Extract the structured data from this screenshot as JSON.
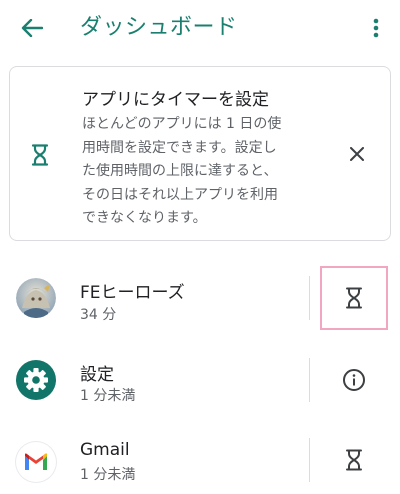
{
  "header": {
    "title": "ダッシュボード",
    "back_icon": "arrow-back-icon",
    "menu_icon": "more-vert-icon"
  },
  "timer_card": {
    "title": "アプリにタイマーを設定",
    "body_lines": [
      "ほとんどのアプリには 1 日の使",
      "用時間を設定できます。設定し",
      "た使用時間の上限に達すると、",
      "その日はそれ以上アプリを利用",
      "できなくなります。"
    ],
    "icon": "hourglass-icon",
    "dismiss_icon": "close-icon"
  },
  "apps": [
    {
      "name": "FEヒーローズ",
      "usage": "34 分",
      "icon": "fe-heroes-app-icon",
      "action_icon": "hourglass-icon"
    },
    {
      "name": "設定",
      "usage": "1 分未満",
      "icon": "settings-app-icon",
      "action_icon": "info-icon"
    },
    {
      "name": "Gmail",
      "usage": "1 分未満",
      "icon": "gmail-app-icon",
      "action_icon": "hourglass-icon"
    }
  ],
  "colors": {
    "accent": "#1a7f6f",
    "settings_icon_bg": "#12756a",
    "highlight_border": "#f1a7c1"
  }
}
